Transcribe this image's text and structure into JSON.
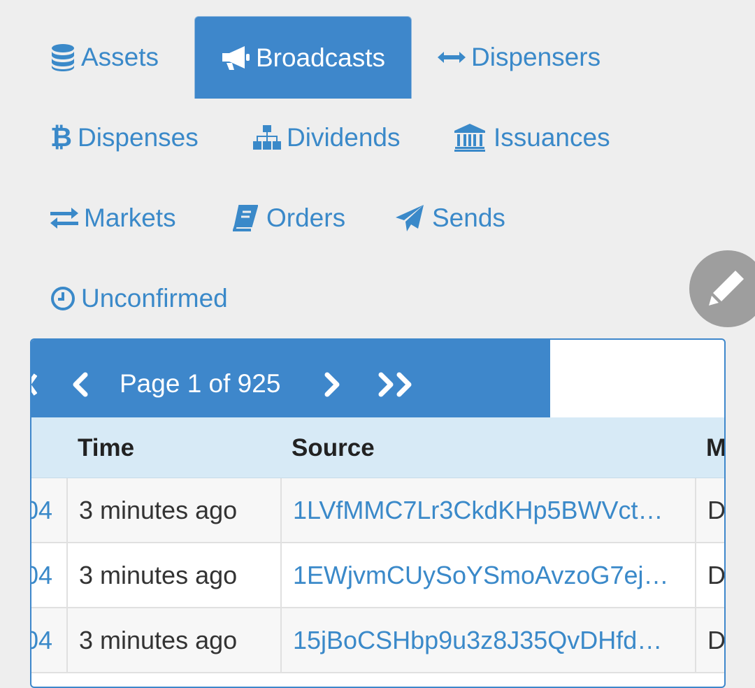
{
  "nav": {
    "assets": {
      "label": "Assets",
      "icon": "database-icon"
    },
    "broadcasts": {
      "label": "Broadcasts",
      "icon": "bullhorn-icon",
      "active": true
    },
    "dispensers": {
      "label": "Dispensers",
      "icon": "arrows-h-icon"
    },
    "dispenses": {
      "label": "Dispenses",
      "icon": "bitcoin-icon"
    },
    "dividends": {
      "label": "Dividends",
      "icon": "sitemap-icon"
    },
    "issuances": {
      "label": "Issuances",
      "icon": "bank-icon"
    },
    "markets": {
      "label": "Markets",
      "icon": "exchange-icon"
    },
    "orders": {
      "label": "Orders",
      "icon": "book-icon"
    },
    "sends": {
      "label": "Sends",
      "icon": "paper-plane-icon"
    },
    "unconfirmed": {
      "label": "Unconfirmed",
      "icon": "clock-icon"
    }
  },
  "fab": {
    "icon": "pencil-icon"
  },
  "pager": {
    "page_text": "Page 1 of 925",
    "prev_icon": "chevron-left-icon",
    "next_icon": "chevron-right-icon",
    "last_icon": "double-chevron-right-icon"
  },
  "table": {
    "columns": [
      "Time",
      "Source",
      "M"
    ],
    "rows": [
      {
        "id": "04",
        "time": "3 minutes ago",
        "source": "1LVfMMC7Lr3CkdKHp5BWVct…",
        "message": "D"
      },
      {
        "id": "04",
        "time": "3 minutes ago",
        "source": "1EWjvmCUySoYSmoAvzoG7ej…",
        "message": "D"
      },
      {
        "id": "04",
        "time": "3 minutes ago",
        "source": "15jBoCSHbp9u3z8J35QvDHfd…",
        "message": "D"
      }
    ]
  },
  "colors": {
    "accent": "#3e87cb",
    "link": "#3a89c9",
    "header_bg": "#d7eaf6",
    "page_bg": "#eeeeee"
  }
}
